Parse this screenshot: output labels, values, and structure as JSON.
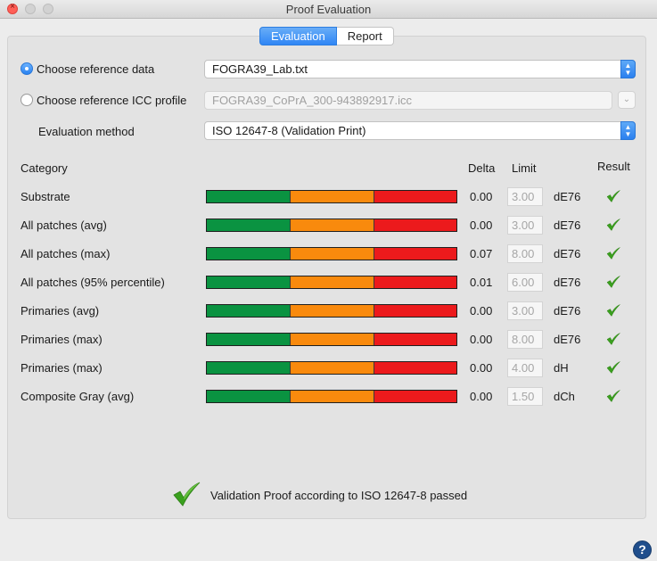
{
  "window": {
    "title": "Proof Evaluation"
  },
  "tabs": [
    {
      "label": "Evaluation",
      "active": true
    },
    {
      "label": "Report",
      "active": false
    }
  ],
  "reference": {
    "data_label": "Choose reference data",
    "data_value": "FOGRA39_Lab.txt",
    "icc_label": "Choose reference ICC profile",
    "icc_value": "FOGRA39_CoPrA_300-943892917.icc",
    "selected": "data"
  },
  "evaluation": {
    "method_label": "Evaluation method",
    "method_value": "ISO 12647-8 (Validation Print)"
  },
  "table": {
    "headers": {
      "category": "Category",
      "delta": "Delta",
      "limit": "Limit",
      "result": "Result"
    },
    "rows": [
      {
        "category": "Substrate",
        "delta": "0.00",
        "limit": "3.00",
        "unit": "dE76",
        "passed": true
      },
      {
        "category": "All patches (avg)",
        "delta": "0.00",
        "limit": "3.00",
        "unit": "dE76",
        "passed": true
      },
      {
        "category": "All patches (max)",
        "delta": "0.07",
        "limit": "8.00",
        "unit": "dE76",
        "passed": true
      },
      {
        "category": "All patches (95% percentile)",
        "delta": "0.01",
        "limit": "6.00",
        "unit": "dE76",
        "passed": true
      },
      {
        "category": "Primaries (avg)",
        "delta": "0.00",
        "limit": "3.00",
        "unit": "dE76",
        "passed": true
      },
      {
        "category": "Primaries (max)",
        "delta": "0.00",
        "limit": "8.00",
        "unit": "dE76",
        "passed": true
      },
      {
        "category": "Primaries (max)",
        "delta": "0.00",
        "limit": "4.00",
        "unit": "dH",
        "passed": true
      },
      {
        "category": "Composite Gray (avg)",
        "delta": "0.00",
        "limit": "1.50",
        "unit": "dCh",
        "passed": true
      }
    ]
  },
  "summary": {
    "text": "Validation Proof according to ISO 12647-8 passed",
    "passed": true
  },
  "help": {
    "label": "?"
  },
  "colors": {
    "accent": "#2f86f5",
    "green": "#0a9341",
    "orange": "#f98a0d",
    "red": "#ec1a1c",
    "check": "#3aa01e"
  }
}
